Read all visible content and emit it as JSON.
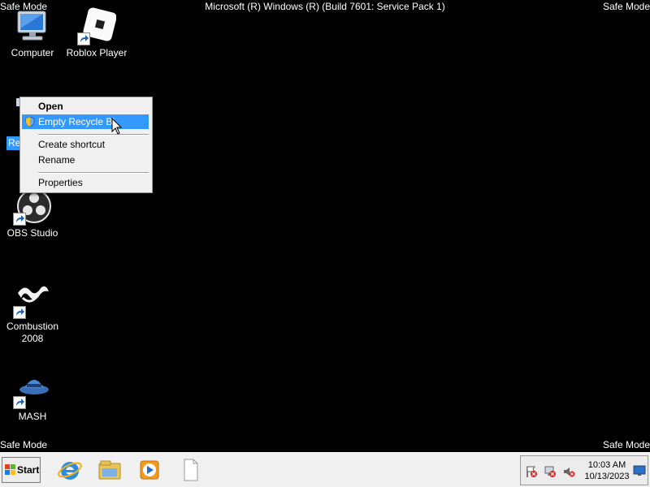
{
  "safe_mode": {
    "top_left": "Safe Mode",
    "top_right": "Safe Mode",
    "bottom_left": "Safe Mode",
    "bottom_right": "Safe Mode"
  },
  "build_string": "Microsoft (R) Windows (R) (Build 7601: Service Pack 1)",
  "desktop_icons": {
    "computer": "Computer",
    "roblox": "Roblox Player",
    "recycle_partial": "Re",
    "obs": "OBS Studio",
    "combustion_line1": "Combustion",
    "combustion_line2": "2008",
    "mash": "MASH"
  },
  "context_menu": {
    "open": "Open",
    "empty": "Empty Recycle Bi",
    "create_shortcut": "Create shortcut",
    "rename": "Rename",
    "properties": "Properties"
  },
  "taskbar": {
    "start_label": "Start",
    "clock_time": "10:03 AM",
    "clock_date": "10/13/2023",
    "pinned": [
      "internet-explorer-icon",
      "windows-explorer-icon",
      "media-player-icon",
      "blank-document-icon"
    ]
  },
  "colors": {
    "desktop_bg": "#000000",
    "selection": "#3399ff",
    "menu_bg": "#f0f0f0",
    "taskbar_bg": "#f0f0f0"
  }
}
